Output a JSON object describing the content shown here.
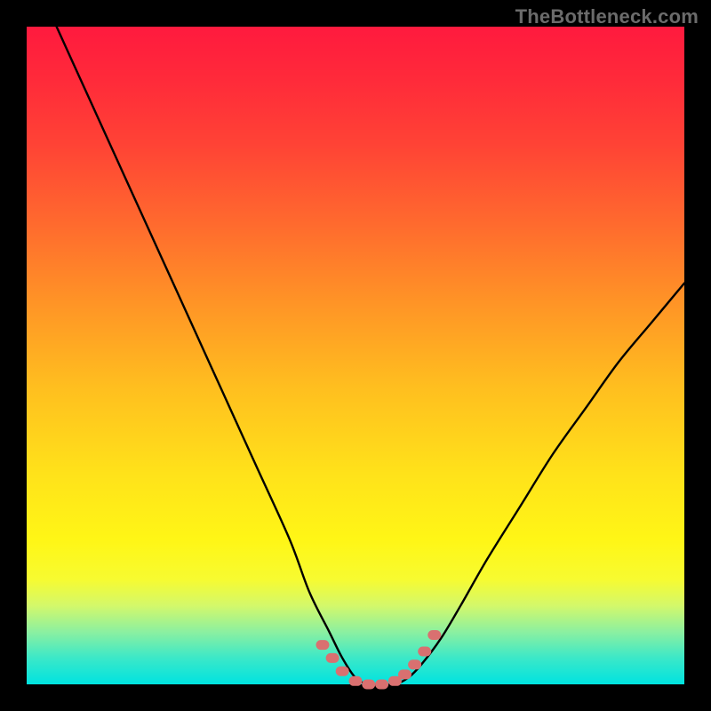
{
  "watermark": "TheBottleneck.com",
  "colors": {
    "frame_border": "#000000",
    "curve_stroke": "#000000",
    "marker_fill": "#d97070",
    "gradient_stops": [
      "#ff1a3e",
      "#ff4335",
      "#ff9426",
      "#ffe21a",
      "#fff616",
      "#8cf0a0",
      "#00e3e0"
    ]
  },
  "chart_data": {
    "type": "line",
    "title": "",
    "xlabel": "",
    "ylabel": "",
    "xlim": [
      0,
      100
    ],
    "ylim": [
      0,
      100
    ],
    "grid": false,
    "legend": false,
    "x": [
      0,
      5,
      10,
      15,
      20,
      25,
      30,
      35,
      40,
      43,
      46,
      48,
      50,
      52,
      54,
      56,
      58,
      60,
      63,
      66,
      70,
      75,
      80,
      85,
      90,
      95,
      100
    ],
    "y": [
      110,
      99,
      88,
      77,
      66,
      55,
      44,
      33,
      22,
      14,
      8,
      4,
      1,
      0,
      0,
      0,
      1,
      3,
      7,
      12,
      19,
      27,
      35,
      42,
      49,
      55,
      61
    ],
    "markers": {
      "x": [
        45,
        46.5,
        48,
        50,
        52,
        54,
        56,
        57.5,
        59,
        60.5,
        62
      ],
      "y": [
        6,
        4,
        2,
        0.5,
        0,
        0,
        0.5,
        1.5,
        3,
        5,
        7.5
      ]
    }
  }
}
